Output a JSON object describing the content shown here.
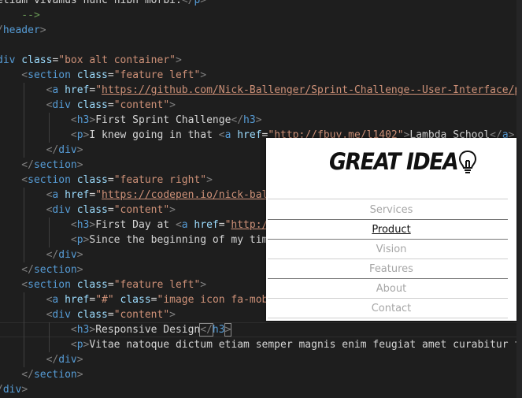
{
  "editor": {
    "lines": [
      {
        "indent": 0,
        "tokens": [
          {
            "t": "etiam vivamus nunc nibh morbi.",
            "c": "text"
          },
          {
            "t": "</",
            "c": "punct"
          },
          {
            "t": "p",
            "c": "tag"
          },
          {
            "t": ">",
            "c": "punct"
          }
        ]
      },
      {
        "indent": 1,
        "tokens": [
          {
            "t": "-->",
            "c": "comment"
          }
        ]
      },
      {
        "indent": 0,
        "tokens": [
          {
            "t": "/",
            "c": "punct"
          },
          {
            "t": "header",
            "c": "tag"
          },
          {
            "t": ">",
            "c": "punct"
          }
        ]
      },
      {
        "indent": 0,
        "tokens": []
      },
      {
        "indent": 0,
        "tokens": [
          {
            "t": "div",
            "c": "tag"
          },
          {
            "t": " class",
            "c": "attr"
          },
          {
            "t": "=",
            "c": "text"
          },
          {
            "t": "\"box alt container\"",
            "c": "str"
          },
          {
            "t": ">",
            "c": "punct"
          }
        ]
      },
      {
        "indent": 1,
        "tokens": [
          {
            "t": "<",
            "c": "punct"
          },
          {
            "t": "section",
            "c": "tag"
          },
          {
            "t": " class",
            "c": "attr"
          },
          {
            "t": "=",
            "c": "text"
          },
          {
            "t": "\"feature left\"",
            "c": "str"
          },
          {
            "t": ">",
            "c": "punct"
          }
        ]
      },
      {
        "indent": 2,
        "tokens": [
          {
            "t": "<",
            "c": "punct"
          },
          {
            "t": "a",
            "c": "tag"
          },
          {
            "t": " href",
            "c": "attr"
          },
          {
            "t": "=",
            "c": "text"
          },
          {
            "t": "\"",
            "c": "str"
          },
          {
            "t": "https://github.com/Nick-Ballenger/Sprint-Challenge--User-Interface/p",
            "c": "link"
          }
        ]
      },
      {
        "indent": 2,
        "tokens": [
          {
            "t": "<",
            "c": "punct"
          },
          {
            "t": "div",
            "c": "tag"
          },
          {
            "t": " class",
            "c": "attr"
          },
          {
            "t": "=",
            "c": "text"
          },
          {
            "t": "\"content\"",
            "c": "str"
          },
          {
            "t": ">",
            "c": "punct"
          }
        ]
      },
      {
        "indent": 3,
        "tokens": [
          {
            "t": "<",
            "c": "punct"
          },
          {
            "t": "h3",
            "c": "tag"
          },
          {
            "t": ">",
            "c": "punct"
          },
          {
            "t": "First Sprint Challenge",
            "c": "text"
          },
          {
            "t": "</",
            "c": "punct"
          },
          {
            "t": "h3",
            "c": "tag"
          },
          {
            "t": ">",
            "c": "punct"
          }
        ]
      },
      {
        "indent": 3,
        "tokens": [
          {
            "t": "<",
            "c": "punct"
          },
          {
            "t": "p",
            "c": "tag"
          },
          {
            "t": ">",
            "c": "punct"
          },
          {
            "t": "I knew going in that ",
            "c": "text"
          },
          {
            "t": "<",
            "c": "punct"
          },
          {
            "t": "a",
            "c": "tag"
          },
          {
            "t": " href",
            "c": "attr"
          },
          {
            "t": "=",
            "c": "text"
          },
          {
            "t": "\"",
            "c": "str"
          },
          {
            "t": "http://fbuy.me/l1402",
            "c": "link"
          },
          {
            "t": "\"",
            "c": "str"
          },
          {
            "t": ">",
            "c": "punct"
          },
          {
            "t": "Lambda School",
            "c": "text"
          },
          {
            "t": "</",
            "c": "punct"
          },
          {
            "t": "a",
            "c": "tag"
          },
          {
            "t": ">",
            "c": "punct"
          }
        ]
      },
      {
        "indent": 2,
        "tokens": [
          {
            "t": "</",
            "c": "punct"
          },
          {
            "t": "div",
            "c": "tag"
          },
          {
            "t": ">",
            "c": "punct"
          }
        ]
      },
      {
        "indent": 1,
        "tokens": [
          {
            "t": "</",
            "c": "punct"
          },
          {
            "t": "section",
            "c": "tag"
          },
          {
            "t": ">",
            "c": "punct"
          }
        ]
      },
      {
        "indent": 1,
        "tokens": [
          {
            "t": "<",
            "c": "punct"
          },
          {
            "t": "section",
            "c": "tag"
          },
          {
            "t": " class",
            "c": "attr"
          },
          {
            "t": "=",
            "c": "text"
          },
          {
            "t": "\"feature right\"",
            "c": "str"
          },
          {
            "t": ">",
            "c": "punct"
          }
        ]
      },
      {
        "indent": 2,
        "tokens": [
          {
            "t": "<",
            "c": "punct"
          },
          {
            "t": "a",
            "c": "tag"
          },
          {
            "t": " href",
            "c": "attr"
          },
          {
            "t": "=",
            "c": "text"
          },
          {
            "t": "\"",
            "c": "str"
          },
          {
            "t": "https://codepen.io/nick-bal",
            "c": "link"
          }
        ]
      },
      {
        "indent": 2,
        "tokens": [
          {
            "t": "<",
            "c": "punct"
          },
          {
            "t": "div",
            "c": "tag"
          },
          {
            "t": " class",
            "c": "attr"
          },
          {
            "t": "=",
            "c": "text"
          },
          {
            "t": "\"content\"",
            "c": "str"
          },
          {
            "t": ">",
            "c": "punct"
          }
        ]
      },
      {
        "indent": 3,
        "tokens": [
          {
            "t": "<",
            "c": "punct"
          },
          {
            "t": "h3",
            "c": "tag"
          },
          {
            "t": ">",
            "c": "punct"
          },
          {
            "t": "First Day at ",
            "c": "text"
          },
          {
            "t": "<",
            "c": "punct"
          },
          {
            "t": "a",
            "c": "tag"
          },
          {
            "t": " href",
            "c": "attr"
          },
          {
            "t": "=",
            "c": "text"
          },
          {
            "t": "\"",
            "c": "str"
          },
          {
            "t": "http:/",
            "c": "link"
          }
        ]
      },
      {
        "indent": 3,
        "tokens": [
          {
            "t": "<",
            "c": "punct"
          },
          {
            "t": "p",
            "c": "tag"
          },
          {
            "t": ">",
            "c": "punct"
          },
          {
            "t": "Since the beginning of my tim",
            "c": "text"
          }
        ]
      },
      {
        "indent": 2,
        "tokens": [
          {
            "t": "</",
            "c": "punct"
          },
          {
            "t": "div",
            "c": "tag"
          },
          {
            "t": ">",
            "c": "punct"
          }
        ]
      },
      {
        "indent": 1,
        "tokens": [
          {
            "t": "</",
            "c": "punct"
          },
          {
            "t": "section",
            "c": "tag"
          },
          {
            "t": ">",
            "c": "punct"
          }
        ]
      },
      {
        "indent": 1,
        "tokens": [
          {
            "t": "<",
            "c": "punct"
          },
          {
            "t": "section",
            "c": "tag"
          },
          {
            "t": " class",
            "c": "attr"
          },
          {
            "t": "=",
            "c": "text"
          },
          {
            "t": "\"feature left\"",
            "c": "str"
          },
          {
            "t": ">",
            "c": "punct"
          }
        ]
      },
      {
        "indent": 2,
        "tokens": [
          {
            "t": "<",
            "c": "punct"
          },
          {
            "t": "a",
            "c": "tag"
          },
          {
            "t": " href",
            "c": "attr"
          },
          {
            "t": "=",
            "c": "text"
          },
          {
            "t": "\"#\"",
            "c": "str"
          },
          {
            "t": " class",
            "c": "attr"
          },
          {
            "t": "=",
            "c": "text"
          },
          {
            "t": "\"image icon fa-mob",
            "c": "str"
          }
        ]
      },
      {
        "indent": 2,
        "tokens": [
          {
            "t": "<",
            "c": "punct"
          },
          {
            "t": "div",
            "c": "tag"
          },
          {
            "t": " class",
            "c": "attr"
          },
          {
            "t": "=",
            "c": "text"
          },
          {
            "t": "\"content\"",
            "c": "str"
          },
          {
            "t": ">",
            "c": "punct"
          }
        ]
      },
      {
        "indent": 3,
        "highlight": true,
        "tokens": [
          {
            "t": "<",
            "c": "punct"
          },
          {
            "t": "h3",
            "c": "tag"
          },
          {
            "t": ">",
            "c": "punct"
          },
          {
            "t": "Responsive Design",
            "c": "text"
          },
          {
            "t": "</",
            "c": "punct",
            "box": true
          },
          {
            "t": "h3",
            "c": "tag"
          },
          {
            "t": ">",
            "c": "punct",
            "box": true
          }
        ]
      },
      {
        "indent": 3,
        "tokens": [
          {
            "t": "<",
            "c": "punct"
          },
          {
            "t": "p",
            "c": "tag"
          },
          {
            "t": ">",
            "c": "punct"
          },
          {
            "t": "Vitae natoque dictum etiam semper magnis enim feugiat amet curabitur t",
            "c": "text"
          }
        ]
      },
      {
        "indent": 2,
        "tokens": [
          {
            "t": "</",
            "c": "punct"
          },
          {
            "t": "div",
            "c": "tag"
          },
          {
            "t": ">",
            "c": "punct"
          }
        ]
      },
      {
        "indent": 1,
        "tokens": [
          {
            "t": "</",
            "c": "punct"
          },
          {
            "t": "section",
            "c": "tag"
          },
          {
            "t": ">",
            "c": "punct"
          }
        ]
      },
      {
        "indent": 0,
        "tokens": [
          {
            "t": "/",
            "c": "punct"
          },
          {
            "t": "div",
            "c": "tag"
          },
          {
            "t": ">",
            "c": "punct"
          }
        ]
      }
    ]
  },
  "preview": {
    "logo_text": "GREAT IDEA",
    "logo_icon": "lightbulb-icon",
    "nav": [
      {
        "label": "Services",
        "active": false
      },
      {
        "label": "Product",
        "active": true
      },
      {
        "label": "Vision",
        "active": false
      },
      {
        "label": "Features",
        "active": false
      },
      {
        "label": "About",
        "active": false
      },
      {
        "label": "Contact",
        "active": false
      }
    ]
  },
  "colors": {
    "editor_bg": "#1e1e1e",
    "tag": "#569cd6",
    "attribute": "#9cdcfe",
    "string": "#ce9178",
    "punctuation": "#808080",
    "text": "#d4d4d4",
    "comment": "#6a9955",
    "nav_inactive": "#a6a6a6",
    "nav_active": "#111111"
  }
}
